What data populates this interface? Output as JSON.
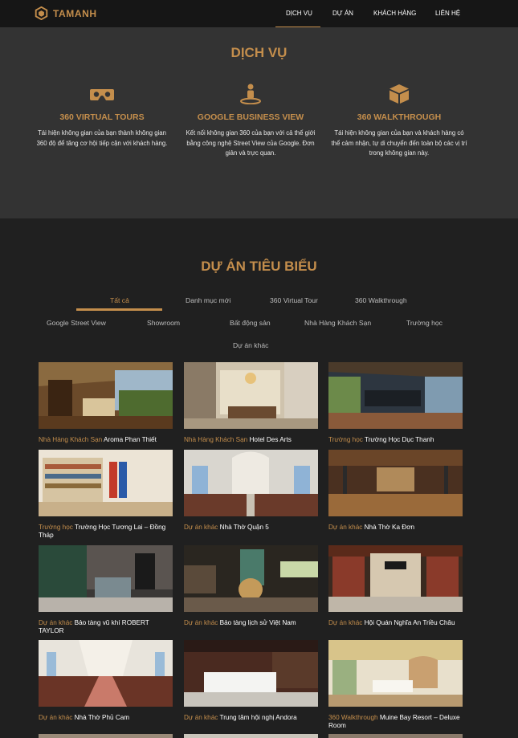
{
  "brand": {
    "name": "TAMANH",
    "accent": "#c48e4c"
  },
  "nav": {
    "links": [
      {
        "label": "DỊCH VỤ",
        "active": true
      },
      {
        "label": "DỰ ÁN",
        "active": false
      },
      {
        "label": "KHÁCH HÀNG",
        "active": false
      },
      {
        "label": "LIÊN HỆ",
        "active": false
      }
    ]
  },
  "services": {
    "title": "DỊCH VỤ",
    "items": [
      {
        "icon": "vr-headset-icon",
        "name": "360 VIRTUAL TOURS",
        "description": "Tái hiện không gian của bạn thành không gian 360 độ để tăng cơ hội tiếp cận với khách hàng."
      },
      {
        "icon": "street-view-icon",
        "name": "GOOGLE BUSINESS VIEW",
        "description": "Kết nối không gian 360 của bạn với cả thế giới bằng công nghệ Street View của Google. Đơn giản và trực quan."
      },
      {
        "icon": "cube-icon",
        "name": "360 WALKTHROUGH",
        "description": "Tái hiện không gian của bạn và khách hàng có thể cảm nhận, tự di chuyển đến toàn bộ các vị trí trong không gian này."
      }
    ]
  },
  "projects": {
    "title": "DỰ ÁN TIÊU BIỂU",
    "filters": [
      {
        "label": "Tất cả",
        "active": true
      },
      {
        "label": "Danh mục mới",
        "active": false
      },
      {
        "label": "360 Virtual Tour",
        "active": false
      },
      {
        "label": "360 Walkthrough",
        "active": false
      },
      {
        "label": "Google Street View",
        "active": false
      },
      {
        "label": "Showroom",
        "active": false
      },
      {
        "label": "Bất động sản",
        "active": false
      },
      {
        "label": "Nhà Hàng Khách Sạn",
        "active": false
      },
      {
        "label": "Trường học",
        "active": false
      },
      {
        "label": "Dự án khác",
        "active": false
      }
    ],
    "items": [
      {
        "category": "Nhà Hàng Khách Sạn",
        "title": "Aroma Phan Thiết"
      },
      {
        "category": "Nhà Hàng Khách Sạn",
        "title": "Hotel Des Arts"
      },
      {
        "category": "Trường học",
        "title": "Trường Học Dục Thanh"
      },
      {
        "category": "Trường học",
        "title": "Trường Học Tương Lai – Đồng Tháp"
      },
      {
        "category": "Dự án khác",
        "title": "Nhà Thờ Quận 5"
      },
      {
        "category": "Dự án khác",
        "title": "Nhà Thờ Ka Đơn"
      },
      {
        "category": "Dự án khác",
        "title": "Bảo tàng vũ khí ROBERT TAYLOR"
      },
      {
        "category": "Dự án khác",
        "title": "Bảo tàng lịch sử Việt Nam"
      },
      {
        "category": "Dự án khác",
        "title": "Hội Quán Nghĩa An Triều Châu"
      },
      {
        "category": "Dự án khác",
        "title": "Nhà Thờ Phủ Cam"
      },
      {
        "category": "Dự án khác",
        "title": "Trung tâm hội nghị Andora"
      },
      {
        "category": "360 Walkthrough",
        "title": "Muine Bay Resort – Deluxe Room"
      }
    ]
  }
}
